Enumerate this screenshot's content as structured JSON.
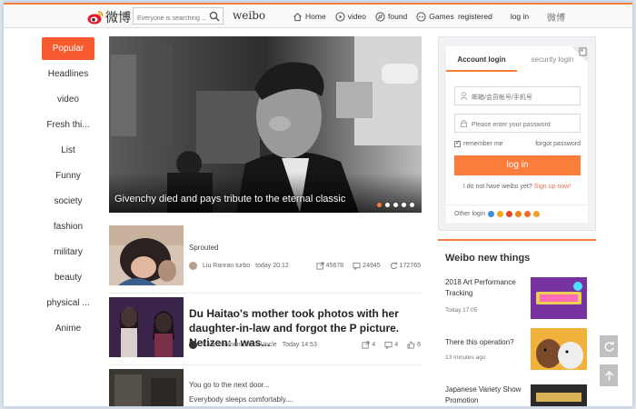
{
  "header": {
    "logo_text": "微博",
    "search_placeholder": "Everyone is searching ...",
    "brand": "weibo",
    "nav": [
      {
        "label": "Home",
        "icon": "home-icon"
      },
      {
        "label": "video",
        "icon": "video-icon"
      },
      {
        "label": "found",
        "icon": "found-icon"
      },
      {
        "label": "Games",
        "icon": "games-icon"
      }
    ],
    "registered": "registered",
    "login": "log in",
    "weibo_cn": "微博"
  },
  "sidebar": {
    "categories": [
      "Popular",
      "Headlines",
      "video",
      "Fresh thi...",
      "List",
      "Funny",
      "society",
      "fashion",
      "military",
      "beauty",
      "physical ...",
      "Anime"
    ],
    "active_index": 0
  },
  "hero": {
    "caption": "Givenchy died and pays tribute to the eternal classic",
    "dot_count": 5,
    "active_dot": 0
  },
  "feed": [
    {
      "sub": "Sprouted",
      "author": "Liu Ranran turbo",
      "time": "today 20:12",
      "shares": "45678",
      "comments": "24945",
      "likes": "172765"
    },
    {
      "title": "Du Haitao's mother took photos with her daughter-in-law and forgot the P picture. Netizen: I was...",
      "author": "Entertainment Stars Uncle",
      "time": "Today 14:53",
      "shares": "4",
      "comments": "4",
      "likes": "6"
    },
    {
      "line1": "You go to the next door...",
      "line2": "Everybody sleeps comfortably...."
    }
  ],
  "login": {
    "tab_account": "Account login",
    "tab_security": "security login",
    "username_placeholder": "邮箱/会员帐号/手机号",
    "password_placeholder": "Please enter your password",
    "remember": "remember me",
    "forgot": "forgot password",
    "button": "log in",
    "no_account": "I do not have weibo yet?",
    "signup": "Sign up now!",
    "other_login": "Other login"
  },
  "new_things": {
    "title": "Weibo new things",
    "items": [
      {
        "text": "2018 Art Performance Tracking",
        "time": "Today 17:05"
      },
      {
        "text": "There this operation?",
        "time": "13 minutes ago"
      },
      {
        "text": "Japanese Variety Show Promotion",
        "time": ""
      }
    ]
  },
  "colors": {
    "accent": "#fa7d3c",
    "active_category": "#f75a2e"
  }
}
